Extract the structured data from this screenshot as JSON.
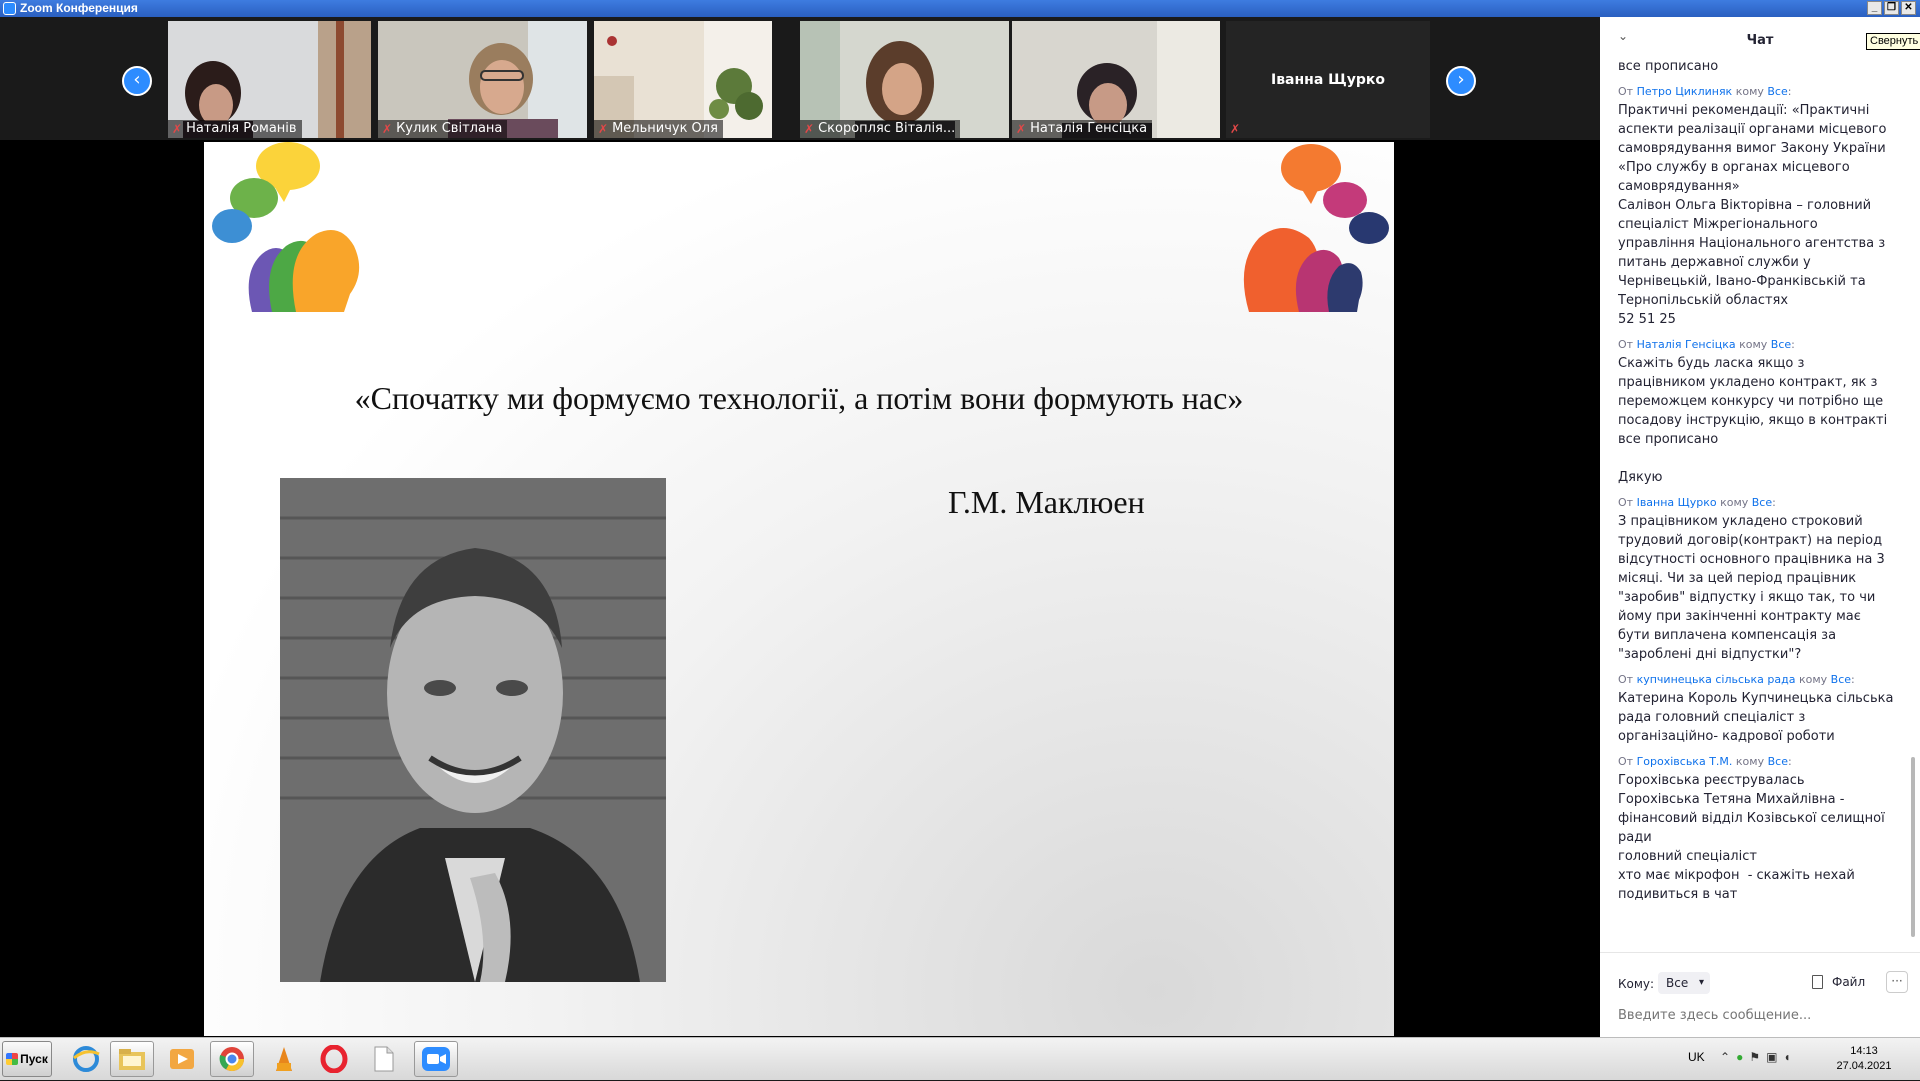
{
  "window": {
    "title": "Zoom Конференция",
    "buttons": [
      "_",
      "❐",
      "✕"
    ]
  },
  "participants": [
    {
      "name": "Наталія Романів",
      "muted": true
    },
    {
      "name": "Кулик Світлана",
      "muted": true
    },
    {
      "name": "Мельничук Оля",
      "muted": true
    },
    {
      "name": "Скоропляс Віталія...",
      "muted": true
    },
    {
      "name": "Наталія Генсіцка",
      "muted": true
    },
    {
      "name": "Іванна Щурко",
      "muted": true,
      "video": false
    }
  ],
  "gallery_nav": {
    "prev_icon": "chevron-left-icon",
    "next_icon": "chevron-right-icon"
  },
  "slide": {
    "quote": "«Спочатку ми формуємо технології, а потім вони формують нас»",
    "author": "Г.М. Маклюен"
  },
  "chat": {
    "title": "Чат",
    "tooltip": "Свернуть",
    "messages": [
      {
        "lines": [
          "все прописано"
        ]
      },
      {
        "from": "Петро Циклиняк",
        "to": "Все",
        "lines": [
          "Практичні рекомендації: «Практичні",
          "аспекти реалізації органами місцевого",
          "самоврядування вимог Закону України",
          "«Про службу в органах місцевого",
          "самоврядування»",
          "Салівон Ольга Вікторівна – головний",
          "спеціаліст Міжрегіонального",
          "управління Національного агентства з",
          "питань державної служби у",
          "Чернівецькій, Івано-Франківській та",
          "Тернопільській областях",
          "52 51 25"
        ]
      },
      {
        "from": "Наталія Генсіцка",
        "to": "Все",
        "lines": [
          "Скажіть будь ласка якщо з",
          "працівником укладено контракт, як з",
          "переможцем конкурсу чи потрібно ще",
          "посадову інструкцію, якщо в контракті",
          "все прописано",
          "",
          "Дякую"
        ]
      },
      {
        "from": "Іванна Щурко",
        "to": "Все",
        "lines": [
          "З працівником укладено строковий",
          "трудовий договір(контракт) на період",
          "відсутності основного працівника на 3",
          "місяці. Чи за цей період працівник",
          "\"заробив\" відпустку і якщо так, то чи",
          "йому при закінченні контракту має",
          "бути виплачена компенсація за",
          "\"зароблені дні відпустки\"?"
        ]
      },
      {
        "from": "купчинецька сільська рада",
        "to": "Все",
        "lines": [
          "Катерина Король Купчинецька сільська",
          "рада головний спеціаліст з",
          "організаційно- кадрової роботи"
        ]
      },
      {
        "from": "Горохівська Т.М.",
        "to": "Все",
        "lines": [
          "Горохівська реєструвалась",
          "Горохівська Тетяна Михайлівна -",
          "фінансовий відділ Козівської селищної",
          "ради",
          "головний спеціаліст",
          "хто має мікрофон  - скажіть нехай",
          "подивиться в чат"
        ]
      }
    ],
    "meta_from": "От",
    "meta_to": "кому",
    "composer": {
      "to_label": "Кому:",
      "to_value": "Все",
      "file_label": "Файл",
      "more_label": "···",
      "placeholder": "Введите здесь сообщение..."
    }
  },
  "taskbar": {
    "start_label": "Пуск",
    "apps": [
      "internet-explorer-icon",
      "file-explorer-icon",
      "media-player-icon",
      "chrome-icon",
      "app-icon",
      "opera-icon",
      "document-icon",
      "zoom-icon"
    ],
    "lang": "UK",
    "time": "14:13",
    "date": "27.04.2021"
  }
}
